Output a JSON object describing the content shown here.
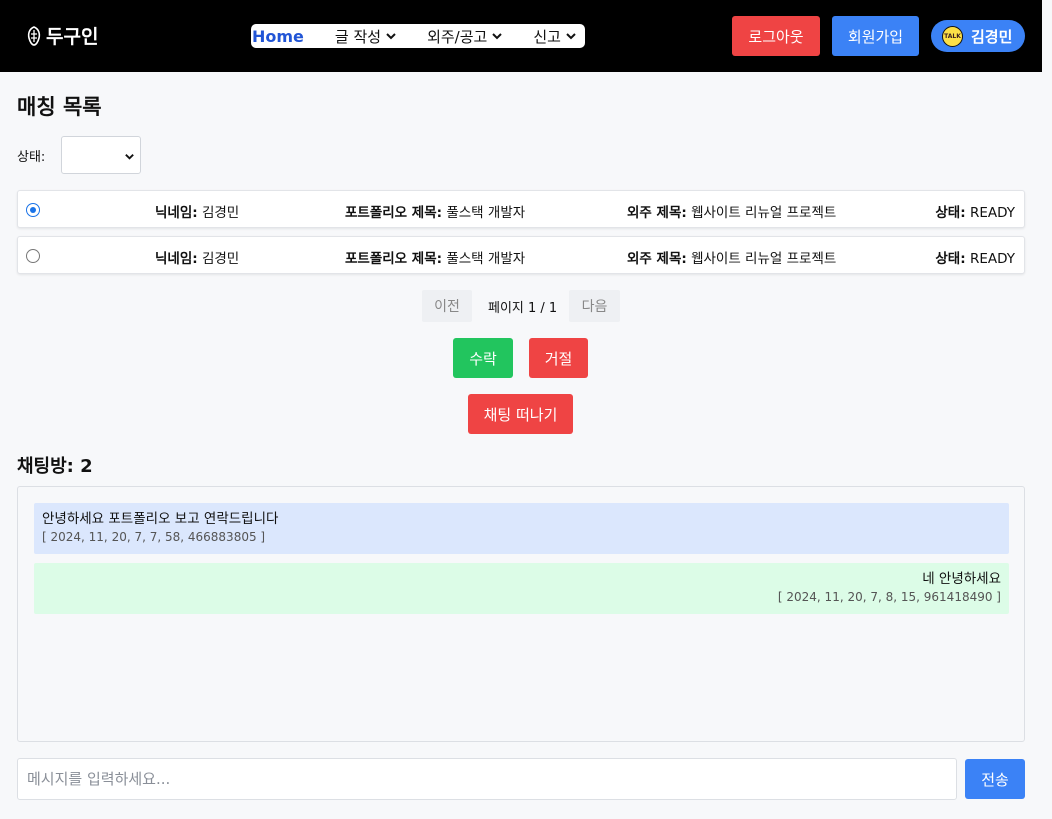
{
  "header": {
    "logo_text": "두구인",
    "nav": {
      "home": "Home",
      "write": "글 작성",
      "outsourcing": "외주/공고",
      "report": "신고"
    },
    "logout_label": "로그아웃",
    "signup_label": "회원가입",
    "user_name": "김경민",
    "talk_badge": "TALK"
  },
  "page_title": "매칭 목록",
  "filter": {
    "status_label": "상태:",
    "status_value": ""
  },
  "labels": {
    "nickname": "닉네임:",
    "portfolio_title": "포트폴리오 제목:",
    "outsourcing_title": "외주 제목:",
    "status": "상태:"
  },
  "matches": [
    {
      "selected": true,
      "nickname": "김경민",
      "portfolio_title": "풀스택 개발자",
      "outsourcing_title": "웹사이트 리뉴얼 프로젝트",
      "status": "READY"
    },
    {
      "selected": false,
      "nickname": "김경민",
      "portfolio_title": "풀스택 개발자",
      "outsourcing_title": "웹사이트 리뉴얼 프로젝트",
      "status": "READY"
    }
  ],
  "pagination": {
    "prev_label": "이전",
    "info": "페이지 1 / 1",
    "next_label": "다음"
  },
  "actions": {
    "accept_label": "수락",
    "reject_label": "거절",
    "leave_chat_label": "채팅 떠나기"
  },
  "chat": {
    "title": "채팅방: 2",
    "messages": [
      {
        "direction": "received",
        "text": "안녕하세요 포트폴리오 보고 연락드립니다",
        "time": "[ 2024, 11, 20, 7, 7, 58, 466883805 ]"
      },
      {
        "direction": "sent",
        "text": "네 안녕하세요",
        "time": "[ 2024, 11, 20, 7, 8, 15, 961418490 ]"
      }
    ],
    "input_placeholder": "메시지를 입력하세요...",
    "input_value": "",
    "send_label": "전송"
  },
  "colors": {
    "header_bg": "#000000",
    "danger": "#ef4444",
    "primary": "#3b82f6",
    "success": "#22c55e",
    "received_bg": "#dbe7fd",
    "sent_bg": "#dcfce7",
    "nav_home": "#2155d6"
  }
}
